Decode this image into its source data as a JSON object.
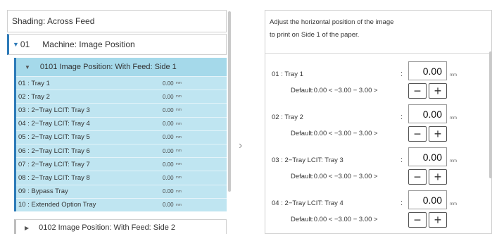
{
  "left": {
    "shading_label": "Shading: Across Feed",
    "machine": {
      "arrow": "▼",
      "number": "01",
      "label": "Machine: Image Position"
    },
    "group1": {
      "arrow": "▼",
      "title": "0101 Image Position: With Feed: Side 1",
      "rows": [
        {
          "label": "01 : Tray 1",
          "value": "0.00",
          "unit": "mm"
        },
        {
          "label": "02 : Tray 2",
          "value": "0.00",
          "unit": "mm"
        },
        {
          "label": "03 : 2−Tray LCIT: Tray 3",
          "value": "0.00",
          "unit": "mm"
        },
        {
          "label": "04 : 2−Tray LCIT: Tray 4",
          "value": "0.00",
          "unit": "mm"
        },
        {
          "label": "05 : 2−Tray LCIT: Tray 5",
          "value": "0.00",
          "unit": "mm"
        },
        {
          "label": "06 : 2−Tray LCIT: Tray 6",
          "value": "0.00",
          "unit": "mm"
        },
        {
          "label": "07 : 2−Tray LCIT: Tray 7",
          "value": "0.00",
          "unit": "mm"
        },
        {
          "label": "08 : 2−Tray LCIT: Tray 8",
          "value": "0.00",
          "unit": "mm"
        },
        {
          "label": "09 : Bypass Tray",
          "value": "0.00",
          "unit": "mm"
        },
        {
          "label": "10 : Extended Option Tray",
          "value": "0.00",
          "unit": "mm"
        }
      ]
    },
    "group2": {
      "arrow": "▶",
      "title": "0102 Image Position: With Feed: Side 2"
    }
  },
  "chevron": "›",
  "right": {
    "description_line1": "Adjust the horizontal position of the image",
    "description_line2": "to print on Side 1 of the paper.",
    "entries": [
      {
        "name": "01 : Tray 1",
        "default": "Default:0.00 < −3.00 − 3.00 >",
        "colon": ":",
        "value": "0.00",
        "unit": "mm",
        "minus": "−",
        "plus": "+"
      },
      {
        "name": "02 : Tray 2",
        "default": "Default:0.00 < −3.00 − 3.00 >",
        "colon": ":",
        "value": "0.00",
        "unit": "mm",
        "minus": "−",
        "plus": "+"
      },
      {
        "name": "03 : 2−Tray LCIT: Tray 3",
        "default": "Default:0.00 < −3.00 − 3.00 >",
        "colon": ":",
        "value": "0.00",
        "unit": "mm",
        "minus": "−",
        "plus": "+"
      },
      {
        "name": "04 : 2−Tray LCIT: Tray 4",
        "default": "Default:0.00 < −3.00 − 3.00 >",
        "colon": ":",
        "value": "0.00",
        "unit": "mm",
        "minus": "−",
        "plus": "+"
      }
    ]
  }
}
